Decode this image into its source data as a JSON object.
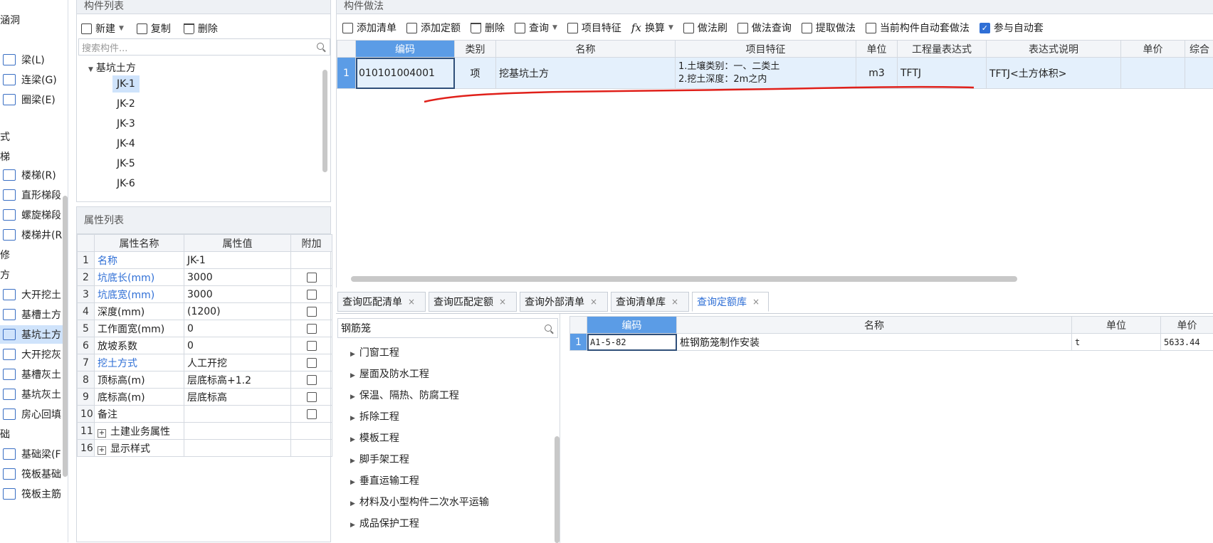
{
  "left_nav": {
    "items": [
      {
        "label": "涵洞",
        "icon": false
      },
      {
        "label": "",
        "icon": false
      },
      {
        "label": "梁(L)",
        "icon": true
      },
      {
        "label": "连梁(G)",
        "icon": true
      },
      {
        "label": "圈梁(E)",
        "icon": true
      },
      {
        "label": "",
        "icon": false
      },
      {
        "label": "式",
        "icon": false
      },
      {
        "label": "梯",
        "icon": false
      },
      {
        "label": "楼梯(R)",
        "icon": true
      },
      {
        "label": "直形梯段",
        "icon": true
      },
      {
        "label": "螺旋梯段",
        "icon": true
      },
      {
        "label": "楼梯井(R",
        "icon": true
      },
      {
        "label": "修",
        "icon": false
      },
      {
        "label": "方",
        "icon": false
      },
      {
        "label": "大开挖土",
        "icon": true
      },
      {
        "label": "基槽土方",
        "icon": true
      },
      {
        "label": "基坑土方",
        "icon": true,
        "active": true
      },
      {
        "label": "大开挖灰",
        "icon": true
      },
      {
        "label": "基槽灰土",
        "icon": true
      },
      {
        "label": "基坑灰土",
        "icon": true
      },
      {
        "label": "房心回填",
        "icon": true
      },
      {
        "label": "础",
        "icon": false
      },
      {
        "label": "基础梁(F",
        "icon": true
      },
      {
        "label": "筏板基础",
        "icon": true
      },
      {
        "label": "筏板主筋",
        "icon": true
      }
    ]
  },
  "component_list": {
    "title": "构件列表",
    "toolbar": {
      "new": "新建",
      "copy": "复制",
      "delete": "删除"
    },
    "search_placeholder": "搜索构件...",
    "group": "基坑土方",
    "items": [
      "JK-1",
      "JK-2",
      "JK-3",
      "JK-4",
      "JK-5",
      "JK-6"
    ]
  },
  "property_list": {
    "title": "属性列表",
    "headers": [
      "属性名称",
      "属性值",
      "附加"
    ],
    "rows": [
      {
        "n": "1",
        "name": "名称",
        "value": "JK-1",
        "blue": true,
        "chk": false
      },
      {
        "n": "2",
        "name": "坑底长(mm)",
        "value": "3000",
        "blue": true,
        "chk": true
      },
      {
        "n": "3",
        "name": "坑底宽(mm)",
        "value": "3000",
        "blue": true,
        "chk": true
      },
      {
        "n": "4",
        "name": "深度(mm)",
        "value": "(1200)",
        "blue": false,
        "chk": true
      },
      {
        "n": "5",
        "name": "工作面宽(mm)",
        "value": "0",
        "blue": false,
        "chk": true
      },
      {
        "n": "6",
        "name": "放坡系数",
        "value": "0",
        "blue": false,
        "chk": true
      },
      {
        "n": "7",
        "name": "挖土方式",
        "value": "人工开挖",
        "blue": true,
        "chk": true
      },
      {
        "n": "8",
        "name": "顶标高(m)",
        "value": "层底标高+1.2",
        "blue": false,
        "chk": true
      },
      {
        "n": "9",
        "name": "底标高(m)",
        "value": "层底标高",
        "blue": false,
        "chk": true
      },
      {
        "n": "10",
        "name": "备注",
        "value": "",
        "blue": false,
        "chk": true
      },
      {
        "n": "11",
        "name": "土建业务属性",
        "value": "",
        "blue": false,
        "chk": false,
        "expand": true
      },
      {
        "n": "16",
        "name": "显示样式",
        "value": "",
        "blue": false,
        "chk": false,
        "expand": true
      }
    ]
  },
  "method_panel": {
    "title": "构件做法",
    "toolbar": [
      "添加清单",
      "添加定额",
      "删除",
      "查询",
      "项目特征",
      "换算",
      "做法刷",
      "做法查询",
      "提取做法",
      "当前构件自动套做法",
      "参与自动套"
    ],
    "headers": [
      "编码",
      "类别",
      "名称",
      "项目特征",
      "单位",
      "工程量表达式",
      "表达式说明",
      "单价",
      "综合"
    ],
    "rows": [
      {
        "n": "1",
        "code": "010101004001",
        "type": "项",
        "name": "挖基坑土方",
        "feature1": "1.土壤类别：一、二类土",
        "feature2": "2.挖土深度：2m之内",
        "unit": "m3",
        "expr": "TFTJ",
        "desc": "TFTJ<土方体积>",
        "price": "",
        "total": ""
      }
    ]
  },
  "query_tabs": [
    {
      "label": "查询匹配清单",
      "active": false
    },
    {
      "label": "查询匹配定额",
      "active": false
    },
    {
      "label": "查询外部清单",
      "active": false
    },
    {
      "label": "查询清单库",
      "active": false
    },
    {
      "label": "查询定额库",
      "active": true
    }
  ],
  "query": {
    "search_value": "钢筋笼",
    "categories": [
      "门窗工程",
      "屋面及防水工程",
      "保温、隔热、防腐工程",
      "拆除工程",
      "模板工程",
      "脚手架工程",
      "垂直运输工程",
      "材料及小型构件二次水平运输",
      "成品保护工程"
    ],
    "headers": [
      "编码",
      "名称",
      "单位",
      "单价"
    ],
    "rows": [
      {
        "n": "1",
        "code": "A1-5-82",
        "name": "桩钢筋笼制作安装",
        "unit": "t",
        "price": "5633.44"
      }
    ]
  },
  "colors": {
    "accent": "#5b9ce6",
    "annotation": "#e0201a",
    "link": "#2f6fd6"
  }
}
